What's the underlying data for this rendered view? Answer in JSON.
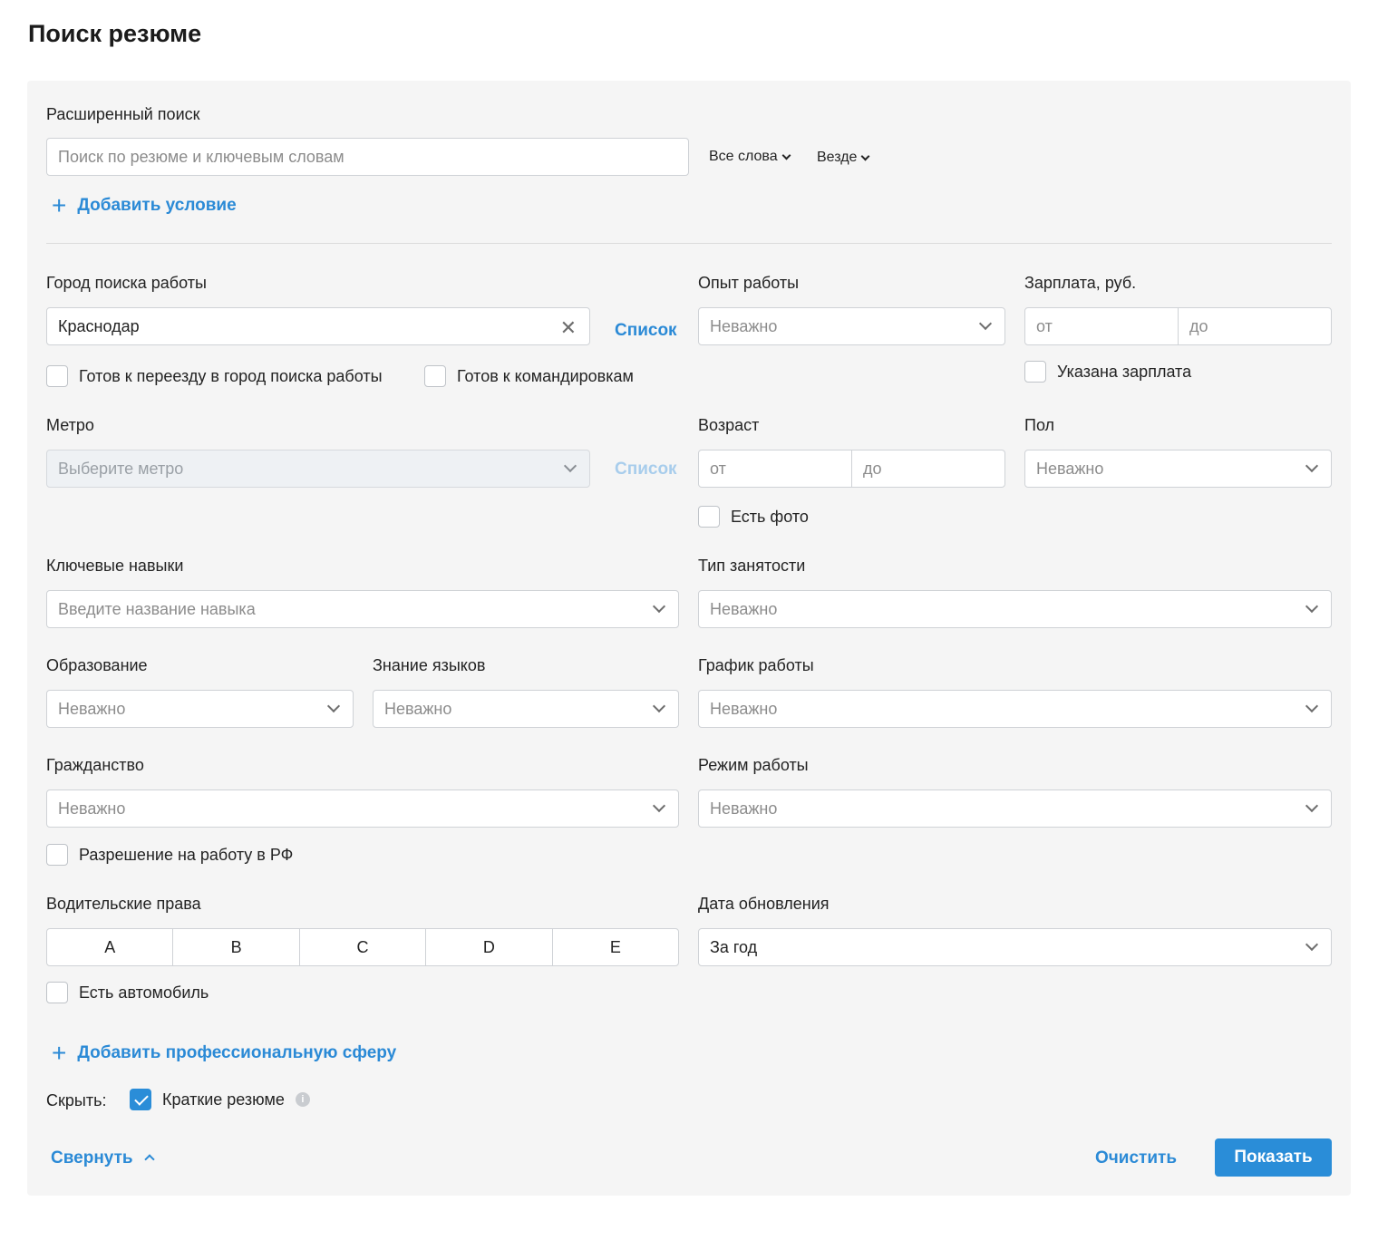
{
  "page_title": "Поиск резюме",
  "advanced": {
    "label": "Расширенный поиск",
    "search_placeholder": "Поиск по резюме и ключевым словам",
    "words_mode": "Все слова",
    "where_mode": "Везде",
    "add_condition": "Добавить условие"
  },
  "city": {
    "label": "Город поиска работы",
    "value": "Краснодар",
    "list_link": "Список",
    "relocate": "Готов к переезду в город поиска работы",
    "business_trips": "Готов к командировкам"
  },
  "experience": {
    "label": "Опыт работы",
    "value": "Неважно"
  },
  "salary": {
    "label": "Зарплата, руб.",
    "from": "от",
    "to": "до",
    "specified": "Указана зарплата"
  },
  "metro": {
    "label": "Метро",
    "placeholder": "Выберите метро",
    "list_link": "Список"
  },
  "age": {
    "label": "Возраст",
    "from": "от",
    "to": "до",
    "has_photo": "Есть фото"
  },
  "gender": {
    "label": "Пол",
    "value": "Неважно"
  },
  "skills": {
    "label": "Ключевые навыки",
    "placeholder": "Введите название навыка"
  },
  "employment": {
    "label": "Тип занятости",
    "value": "Неважно"
  },
  "education": {
    "label": "Образование",
    "value": "Неважно"
  },
  "languages": {
    "label": "Знание языков",
    "value": "Неважно"
  },
  "schedule": {
    "label": "График работы",
    "value": "Неважно"
  },
  "citizenship": {
    "label": "Гражданство",
    "value": "Неважно",
    "work_permit": "Разрешение на работу в РФ"
  },
  "work_mode": {
    "label": "Режим работы",
    "value": "Неважно"
  },
  "license": {
    "label": "Водительские права",
    "categories": [
      "A",
      "B",
      "C",
      "D",
      "E"
    ],
    "has_car": "Есть автомобиль"
  },
  "updated": {
    "label": "Дата обновления",
    "value": "За год"
  },
  "add_sphere": "Добавить профессиональную сферу",
  "hide": {
    "label": "Скрыть:",
    "short_resumes": "Краткие резюме"
  },
  "footer": {
    "collapse": "Свернуть",
    "clear": "Очистить",
    "show": "Показать"
  },
  "colors": {
    "accent": "#2a8dd8",
    "panel": "#f5f5f5"
  }
}
